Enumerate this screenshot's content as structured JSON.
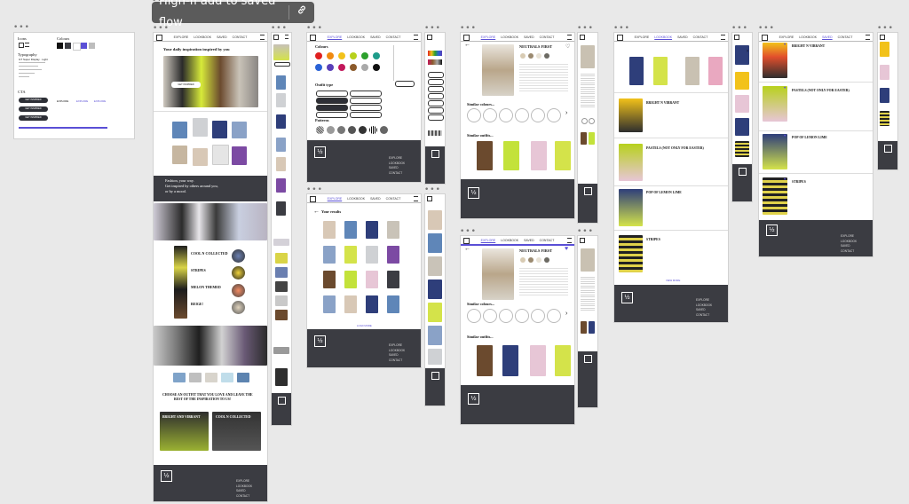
{
  "flow": {
    "title": "High-fi add to saved flow",
    "link_icon": "link-icon"
  },
  "style_guide": {
    "icons_label": "Icons",
    "colours_label": "Colours",
    "typography_label": "Typography",
    "font_name": "GT Super Display · Light",
    "cta_label": "CTA",
    "get_inspired": "GET INSPIRED",
    "explore_labels": [
      "EXPLORE",
      "EXPLORE",
      "EXPLORE"
    ],
    "swatches": [
      "#111111",
      "#3b3c42",
      "#ffffff",
      "#5a4fd6",
      "#bdbdbd"
    ]
  },
  "nav": {
    "items": [
      "EXPLORE",
      "LOOKBOOK",
      "SAVED",
      "CONTACT"
    ]
  },
  "footer": {
    "logo": "½",
    "links": [
      "EXPLORE",
      "LOOKBOOK",
      "SAVED",
      "CONTACT"
    ]
  },
  "home": {
    "heading": "Your daily inspiration inspired by you",
    "hero_button": "GET INSPIRED",
    "quote_line1": "Fashion, your way.",
    "quote_line2": "Get inspired by others around you,",
    "quote_line3": "or by a mood.",
    "collections": [
      "COOL N COLLECTED",
      "STRIPES",
      "MELON THEMED",
      "BEIGE!"
    ],
    "choose_text_line1": "CHOOSE AN OUTFIT THAT YOU LOVE AND LEAVE THE",
    "choose_text_line2": "REST OF THE INSPIRATION TO US!",
    "cards": [
      "BRIGHT AND VIBRANT",
      "COOL N COLLECTED"
    ]
  },
  "explore_filters": {
    "colours_label": "Colours",
    "outfit_type_label": "Outfit type",
    "patterns_label": "Patterns",
    "colour_dots": [
      "#e02020",
      "#f08a10",
      "#f2c21a",
      "#b7d11c",
      "#2ca02c",
      "#1e9c8a",
      "#2a62d6",
      "#5a3fb8",
      "#c2185b",
      "#8b5a2b",
      "#a9a9a9",
      "#111111"
    ]
  },
  "results": {
    "heading": "Your results",
    "load_more": "LOAD MORE"
  },
  "detail": {
    "title": "NEUTRALS FIRST",
    "similar_colours": "Similar colours...",
    "similar_outfits": "Similar outfits..."
  },
  "lookbook": {
    "items": [
      "BRIGHT N VIBRANT",
      "PASTELS (NOT ONLY FOR EASTER)",
      "POP OF LEMON LIME",
      "STRIPES"
    ],
    "view_more": "VIEW MORE"
  },
  "saved": {
    "items": [
      "BRIGHT N VIBRANT",
      "PASTELS (NOT ONLY FOR EASTER)",
      "POP OF LEMON LIME",
      "STRIPES"
    ]
  }
}
